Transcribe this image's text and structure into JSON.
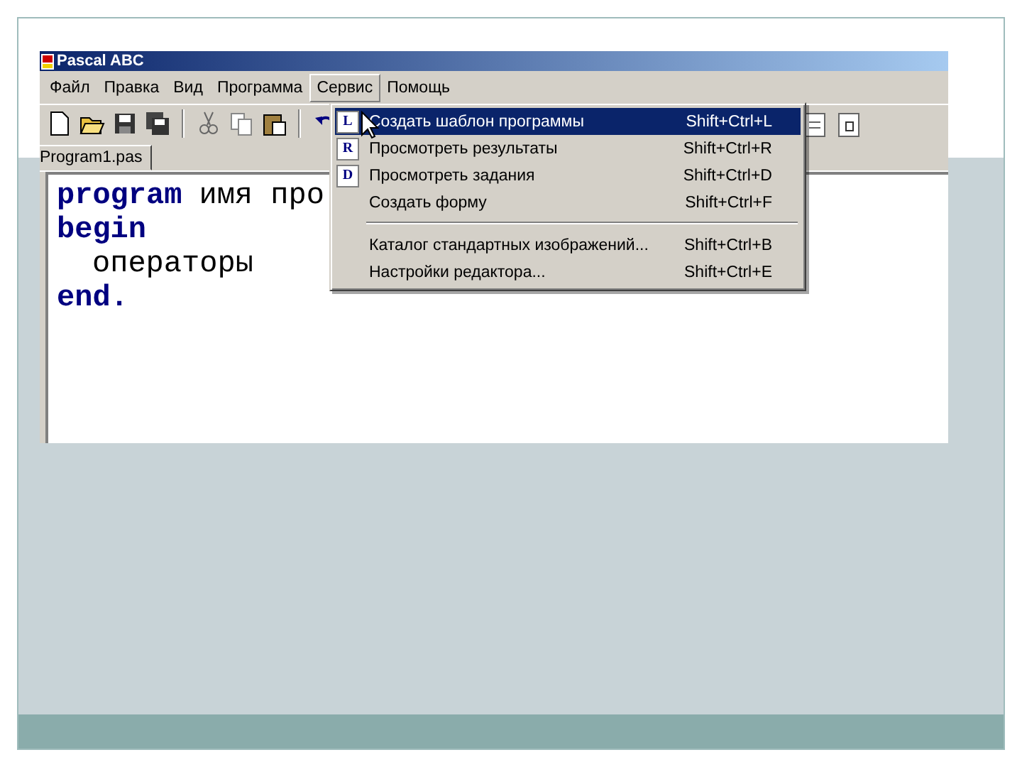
{
  "window": {
    "title": "Pascal ABC"
  },
  "menu_bar": [
    {
      "label": "Файл",
      "selected": false
    },
    {
      "label": "Правка",
      "selected": false
    },
    {
      "label": "Вид",
      "selected": false
    },
    {
      "label": "Программа",
      "selected": false
    },
    {
      "label": "Сервис",
      "selected": true
    },
    {
      "label": "Помощь",
      "selected": false
    }
  ],
  "tabs": [
    {
      "label": "Program1.pas",
      "selected": true
    }
  ],
  "editor": {
    "lines": [
      {
        "indented": false,
        "parts": [
          {
            "text": "program",
            "kind": "keyword"
          },
          {
            "text": "имя про",
            "kind": "plain"
          }
        ]
      },
      {
        "indented": false,
        "parts": [
          {
            "text": "begin",
            "kind": "keyword"
          }
        ]
      },
      {
        "indented": true,
        "parts": [
          {
            "text": "операторы",
            "kind": "plain"
          }
        ]
      },
      {
        "indented": false,
        "parts": [
          {
            "text": "end.",
            "kind": "keyword"
          }
        ]
      }
    ]
  },
  "dropdown": {
    "items": [
      {
        "kind": "command",
        "label": "Создать шаблон программы",
        "shortcut": "Shift+Ctrl+L",
        "icon": "L",
        "selected": true
      },
      {
        "kind": "command",
        "label": "Просмотреть результаты",
        "shortcut": "Shift+Ctrl+R",
        "icon": "R",
        "selected": false
      },
      {
        "kind": "command",
        "label": "Просмотреть задания",
        "shortcut": "Shift+Ctrl+D",
        "icon": "D",
        "selected": false
      },
      {
        "kind": "command",
        "label": "Создать форму",
        "shortcut": "Shift+Ctrl+F",
        "selected": false
      },
      {
        "kind": "separator"
      },
      {
        "kind": "command",
        "label": "Каталог стандартных изображений...",
        "shortcut": "Shift+Ctrl+B",
        "selected": false
      },
      {
        "kind": "command",
        "label": "Настройки редактора...",
        "shortcut": "Shift+Ctrl+E",
        "selected": false
      }
    ]
  }
}
